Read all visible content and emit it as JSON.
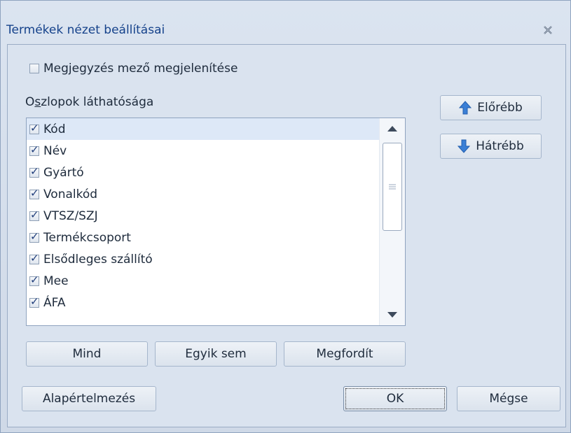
{
  "dialog": {
    "title": "Termékek nézet beállításai",
    "close_icon": "close-icon"
  },
  "memo_checkbox": {
    "label": "Megjegyzés mező megjelenítése",
    "checked": false
  },
  "columns": {
    "label_prefix": "O",
    "label_underlined": "s",
    "label_rest": "zlopok láthatósága",
    "items": [
      {
        "label": "Kód",
        "checked": true,
        "selected": true
      },
      {
        "label": "Név",
        "checked": true
      },
      {
        "label": "Gyártó",
        "checked": true
      },
      {
        "label": "Vonalkód",
        "checked": true
      },
      {
        "label": "VTSZ/SZJ",
        "checked": true
      },
      {
        "label": "Termékcsoport",
        "checked": true
      },
      {
        "label": "Elsődleges szállító",
        "checked": true
      },
      {
        "label": "Mee",
        "checked": true
      },
      {
        "label": "ÁFA",
        "checked": true
      }
    ]
  },
  "buttons": {
    "up": "Előrébb",
    "down": "Hátrébb",
    "all": "Mind",
    "none": "Egyik sem",
    "invert": "Megfordít",
    "defaults": "Alapértelmezés",
    "ok": "OK",
    "cancel": "Mégse"
  },
  "colors": {
    "arrow_blue": "#3a7fd6",
    "accent": "#15428b"
  }
}
